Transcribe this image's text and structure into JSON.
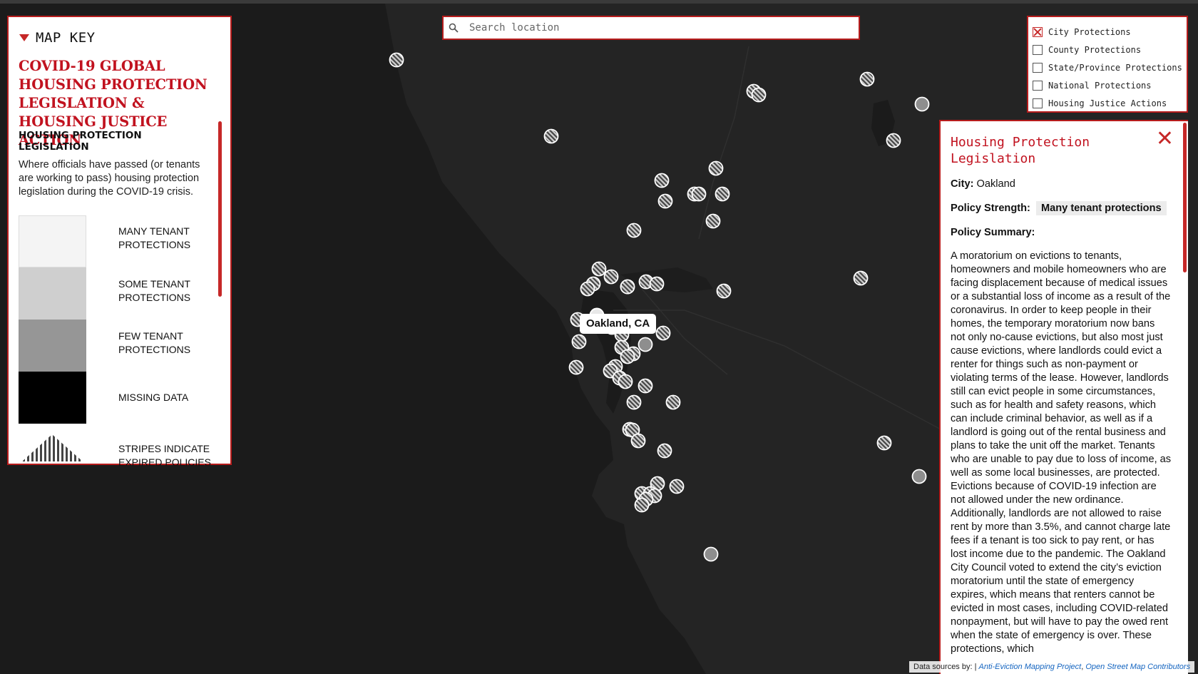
{
  "key_panel": {
    "toggle_label": "MAP KEY",
    "title": "COVID-19 GLOBAL HOUSING PROTECTION LEGISLATION & HOUSING JUSTICE ACTION",
    "legend_heading": "HOUSING PROTECTION LEGISLATION",
    "legend_description": "Where officials have passed (or tenants are working to pass) housing protection legislation during the COVID-19 crisis.",
    "legend_items": [
      {
        "label": "MANY TENANT PROTECTIONS",
        "color": "#f4f4f4"
      },
      {
        "label": "SOME TENANT PROTECTIONS",
        "color": "#cfcfcf"
      },
      {
        "label": "FEW TENANT PROTECTIONS",
        "color": "#969696"
      },
      {
        "label": "MISSING DATA",
        "color": "#000000"
      },
      {
        "label": "STRIPES INDICATE EXPIRED POLICIES",
        "color": "striped"
      }
    ]
  },
  "search": {
    "placeholder": "Search location",
    "icon": "search-icon"
  },
  "filters": [
    {
      "label": "City Protections",
      "checked": true
    },
    {
      "label": "County Protections",
      "checked": false
    },
    {
      "label": "State/Province Protections",
      "checked": false
    },
    {
      "label": "National Protections",
      "checked": false
    },
    {
      "label": "Housing Justice Actions",
      "checked": false
    }
  ],
  "tooltip": {
    "label": "Oakland, CA"
  },
  "info_panel": {
    "title": "Housing Protection Legislation",
    "city_label": "City:",
    "city": "Oakland",
    "strength_label": "Policy Strength:",
    "strength": "Many tenant protections",
    "summary_label": "Policy Summary:",
    "summary": "A moratorium on evictions to tenants, homeowners and mobile homeowners who are facing displacement because of medical issues or a substantial loss of income as a result of the coronavirus. In order to keep people in their homes, the temporary moratorium now bans not only no-cause evictions, but also most just cause evictions, where landlords could evict a renter for things such as non-payment or violating terms of the lease. However, landlords still can evict people in some circumstances, such as for health and safety reasons, which can include criminal behavior, as well as if a landlord is going out of the rental business and plans to take the unit off the market. Tenants who are unable to pay due to loss of income, as well as some local businesses, are protected. Evictions because of COVID-19 infection are not allowed under the new ordinance. Additionally, landlords are not allowed to raise rent by more than 3.5%, and cannot charge late fees if a tenant is too sick to pay rent, or has lost income due to the pandemic. The Oakland City Council voted to extend the city’s eviction moratorium until the state of emergency expires, which means that renters cannot be evicted in most cases, including COVID-related nonpayment, but will have to pay the owed rent when the state of emergency is over. These protections, which"
  },
  "attribution": {
    "prefix": "Data sources by: |",
    "source1": "Anti-Eviction Mapping Project",
    "sep": ",",
    "source2": "Open Street Map Contributors"
  },
  "colors": {
    "accent": "#c1121f",
    "map_land": "#232323",
    "map_water": "#1a1a1a"
  },
  "map_markers": {
    "striped": 52,
    "solid_gray": 5,
    "selected": 1
  }
}
